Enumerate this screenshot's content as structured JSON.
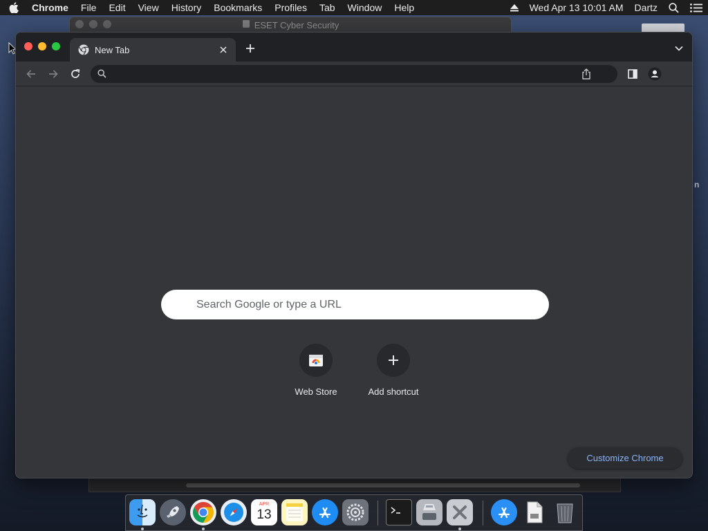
{
  "menubar": {
    "app_name": "Chrome",
    "menus": [
      "File",
      "Edit",
      "View",
      "History",
      "Bookmarks",
      "Profiles",
      "Tab",
      "Window",
      "Help"
    ],
    "datetime": "Wed Apr 13  10:01 AM",
    "user": "Dartz"
  },
  "background_window": {
    "title": "ESET Cyber Security"
  },
  "background_edge_text": "n",
  "browser": {
    "tab": {
      "title": "New Tab"
    },
    "omnibox": {
      "value": "",
      "placeholder": ""
    },
    "new_tab_page": {
      "search_placeholder": "Search Google or type a URL",
      "shortcuts": [
        {
          "label": "Web Store",
          "icon": "web-store-icon"
        },
        {
          "label": "Add shortcut",
          "icon": "plus-icon"
        }
      ],
      "customize_label": "Customize Chrome"
    }
  },
  "dock": {
    "calendar_month": "APR",
    "calendar_day": "13",
    "apps": [
      "finder-icon",
      "launchpad-icon",
      "chrome-icon",
      "safari-icon",
      "calendar-icon",
      "notes-icon",
      "app-store-icon",
      "system-preferences-icon",
      "terminal-icon",
      "disk-utility-icon",
      "x-app-icon",
      "app-store-folder-icon",
      "document-icon",
      "trash-icon"
    ]
  },
  "colors": {
    "menubar_bg": "#1e1e1f",
    "tabstrip_bg": "#202124",
    "toolbar_bg": "#35363a",
    "accent_link": "#8ab4f8",
    "close_light": "#ff5f57",
    "minimize_light": "#febc2e",
    "zoom_light": "#28c840"
  }
}
